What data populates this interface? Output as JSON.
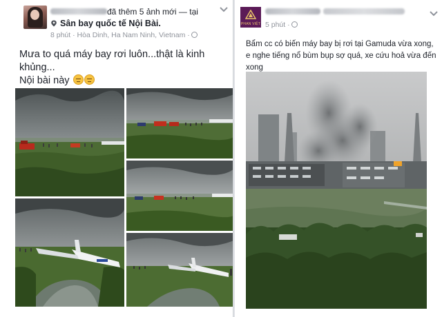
{
  "left_post": {
    "action_text": "đã thêm 5 ảnh mới — tại",
    "place": "Sân bay quốc tế Nội Bài.",
    "meta": "8 phút · Hòa Dinh, Ha Nam Ninh, Vietnam ·",
    "body_line1": "Mưa to quá máy bay rơi luôn...thật là kinh khủng...",
    "body_line2": "Nội bài này",
    "photo_icons": [
      "dark-cloud-airfield",
      "fire-trucks-on-field",
      "crowd-near-tarmac",
      "crashed-plane-in-ditch",
      "plane-off-runway"
    ]
  },
  "right_post": {
    "meta": "5 phút ·",
    "body": "Bẩm cc có biến máy bay bị rơi tại Gamuda vừa xong, e nghe tiếng nổ bùm bụp sợ quá, xe cứu hoả vừa đến xong",
    "avatar_text": "PHAN VIỆT",
    "photo_icon": "smoke-over-buildings"
  },
  "colors": {
    "link_gray": "#90949c",
    "text": "#1d2129",
    "avatar_brand": "#5b1b57",
    "divider": "#d0d3d8"
  },
  "icons": [
    "location-pin-icon",
    "globe-icon",
    "chevron-down-icon",
    "emoji-icon"
  ]
}
